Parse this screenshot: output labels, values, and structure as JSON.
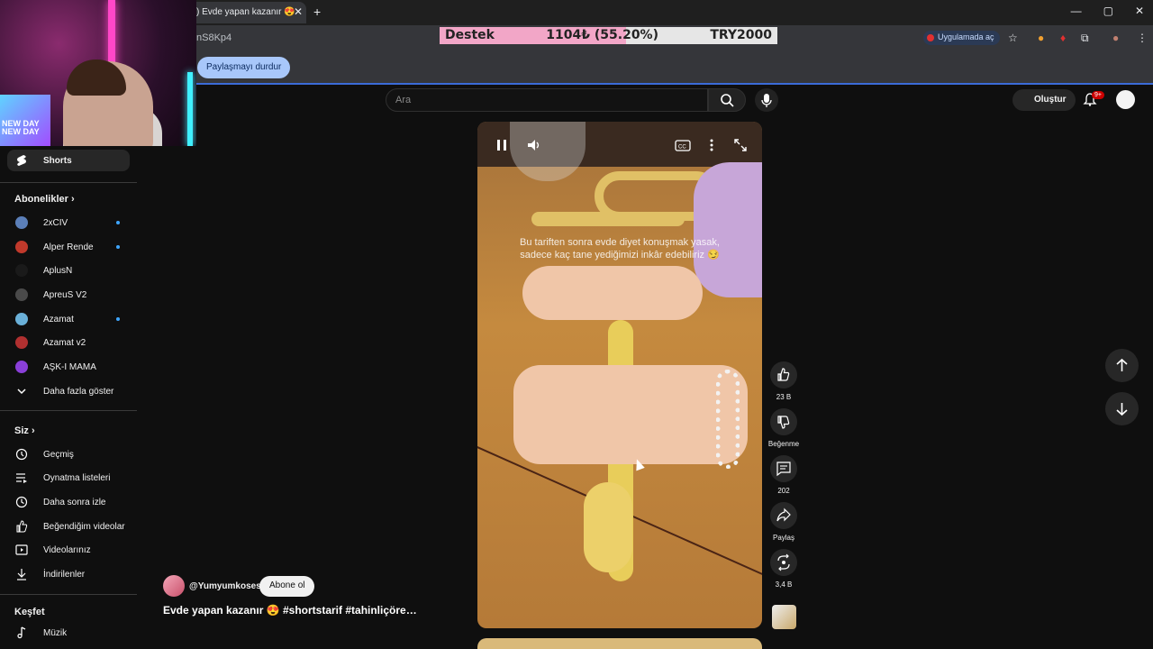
{
  "browser": {
    "tab_title": ") Evde yapan kazanır 😍",
    "tab_close": "✕",
    "new_tab": "+",
    "url": "nS8Kp4",
    "open_in_app": "Uygulamada aç",
    "window_controls": [
      "—",
      "▢",
      "✕"
    ],
    "stop_sharing": "Paylaşmayı durdur"
  },
  "donation": {
    "label": "Destek",
    "amount": "1104₺ (55.20%)",
    "goal": "TRY2000",
    "progress_fraction": 0.552,
    "color_fill": "#f2a6c7"
  },
  "webcam": {
    "overlay_text": "NEW DAY NEW DAY"
  },
  "header": {
    "search_placeholder": "Ara",
    "create_label": "Oluştur",
    "notification_count": "9+"
  },
  "sidebar": {
    "shorts_label": "Shorts",
    "subscriptions_header": "Abonelikler",
    "subscriptions": [
      {
        "label": "2xCIV",
        "new": true,
        "color": "#5b7fb8"
      },
      {
        "label": "Alper Rende",
        "new": true,
        "color": "#c0392b"
      },
      {
        "label": "AplusN",
        "new": false,
        "color": "#1a1a1a"
      },
      {
        "label": "ApreuS V2",
        "new": false,
        "color": "#4a4a4a"
      },
      {
        "label": "Azamat",
        "new": true,
        "color": "#6ab0d8"
      },
      {
        "label": "Azamat v2",
        "new": false,
        "color": "#b03030"
      },
      {
        "label": "AŞK-I MAMA",
        "new": false,
        "color": "#8a3fd8"
      }
    ],
    "show_more": "Daha fazla göster",
    "you_header": "Siz",
    "you_items": [
      "Geçmiş",
      "Oynatma listeleri",
      "Daha sonra izle",
      "Beğendiğim videolar",
      "Videolarınız",
      "İndirilenler"
    ],
    "explore_header": "Keşfet",
    "explore_items": [
      "Müzik"
    ]
  },
  "video": {
    "caption_line1": "Bu tariften sonra evde diyet konuşmak yasak,",
    "caption_line2": "sadece kaç tane yediğimizi inkâr edebiliriz 😏",
    "channel": "@Yumyumkosesi",
    "subscribe": "Abone ol",
    "title": "Evde yapan kazanır 😍 #shortstarif #tahinliçöre…"
  },
  "actions": {
    "likes": "23 B",
    "dislike": "Beğenme",
    "comments": "202",
    "share": "Paylaş",
    "remix": "3,4 B"
  }
}
